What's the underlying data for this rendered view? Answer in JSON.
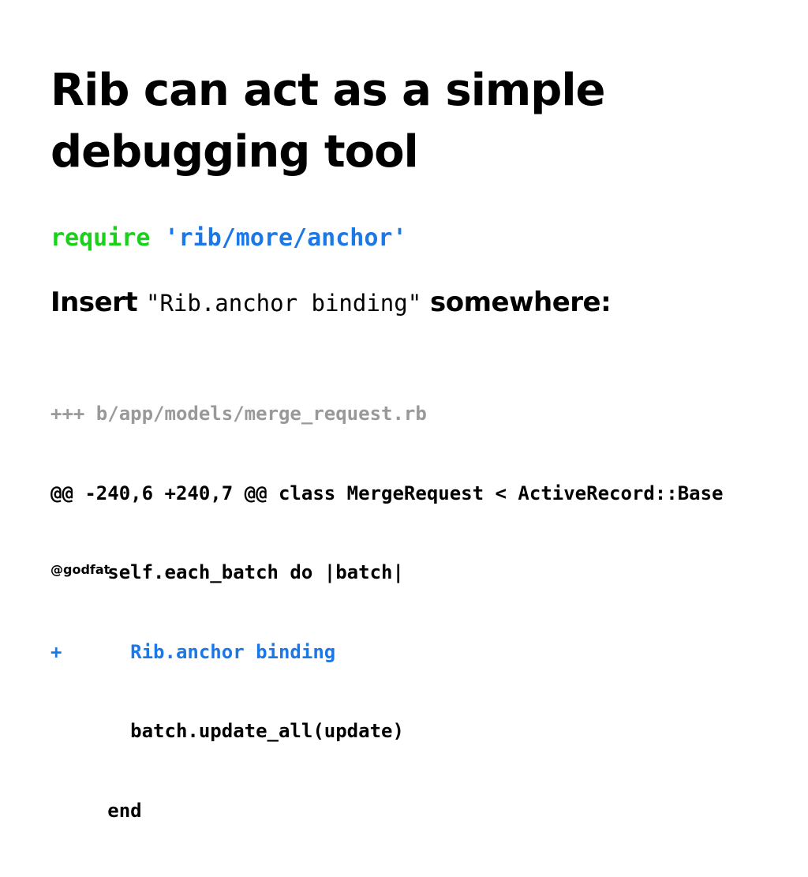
{
  "slide": {
    "title_lines": [
      "Rib can act as a simple",
      "debugging tool"
    ],
    "require": {
      "keyword": "require",
      "string": "'rib/more/anchor'"
    },
    "instruction": {
      "before": "Insert",
      "code": "\"Rib.anchor binding\"",
      "after": "somewhere:"
    },
    "code_lines": [
      "+++ b/app/models/merge_request.rb",
      "@@ -240,6 +240,7 @@ class MergeRequest < ActiveRecord::Base",
      "     self.each_batch do |batch|",
      "+      Rib.anchor binding",
      "       batch.update_all(update)",
      "     end"
    ],
    "footer": "@godfat"
  },
  "colors": {
    "keyword_green": "#1ad11a",
    "string_blue": "#1b78e6",
    "diff_header_gray": "#999999",
    "text_black": "#000000"
  }
}
